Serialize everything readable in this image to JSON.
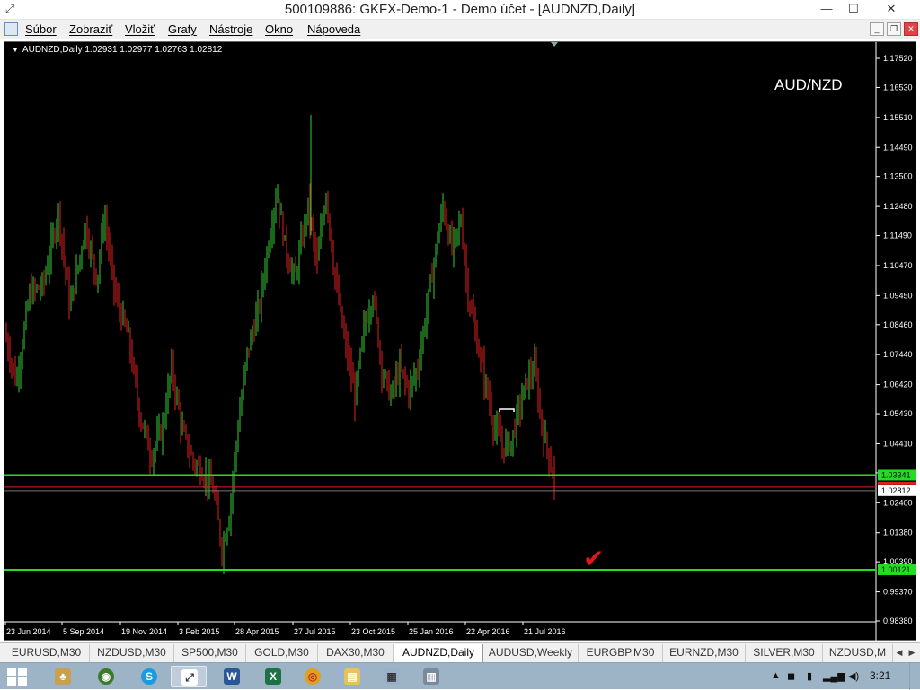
{
  "window": {
    "title": "500109886: GKFX-Demo-1 - Demo účet - [AUDNZD,Daily]",
    "controls": [
      "—",
      "☐",
      "✕"
    ]
  },
  "menu": {
    "items": [
      "Súbor",
      "Zobraziť",
      "Vložiť",
      "Grafy",
      "Nástroje",
      "Okno",
      "Nápoveda"
    ]
  },
  "chart": {
    "header": "AUDNZD,Daily  1.02931 1.02977 1.02763 1.02812",
    "pair_label": "AUD/NZD",
    "price_levels": [
      "1.17520",
      "1.16530",
      "1.15510",
      "1.14490",
      "1.13500",
      "1.12480",
      "1.11490",
      "1.10470",
      "1.09450",
      "1.08460",
      "1.07440",
      "1.06420",
      "1.05430",
      "1.04410",
      "1.03420",
      "1.02400",
      "1.01380",
      "1.00390",
      "0.99370",
      "0.98380"
    ],
    "date_labels": [
      "23 Jun 2014",
      "5 Sep 2014",
      "19 Nov 2014",
      "3 Feb 2015",
      "28 Apr 2015",
      "27 Jul 2015",
      "23 Oct 2015",
      "25 Jan 2016",
      "22 Apr 2016",
      "21 Jul 2016"
    ],
    "levels": {
      "support_upper": "1.03341",
      "current": "1.02812",
      "support_lower": "1.00121"
    },
    "colors": {
      "background": "#000000",
      "bull": "#33cc33",
      "bear": "#e02020",
      "level_line": "#22dd22",
      "bid_line": "#e02020",
      "text": "#ffffff"
    },
    "check_mark": "✔"
  },
  "tabs": [
    {
      "label": "EURUSD,M30"
    },
    {
      "label": "NZDUSD,M30"
    },
    {
      "label": "SP500,M30"
    },
    {
      "label": "GOLD,M30"
    },
    {
      "label": "DAX30,M30"
    },
    {
      "label": "AUDNZD,Daily",
      "active": true
    },
    {
      "label": "AUDUSD,Weekly"
    },
    {
      "label": "EURGBP,M30"
    },
    {
      "label": "EURNZD,M30"
    },
    {
      "label": "SILVER,M30"
    },
    {
      "label": "NZDUSD,M"
    }
  ],
  "taskbar": {
    "clock": "3:21",
    "icons": [
      "windows-start-icon",
      "games-icon",
      "shield-icon",
      "skype-icon",
      "outlook-icon",
      "metatrader-icon",
      "word-icon",
      "excel-icon",
      "chrome-icon",
      "explorer-icon",
      "calculator-icon"
    ]
  }
}
